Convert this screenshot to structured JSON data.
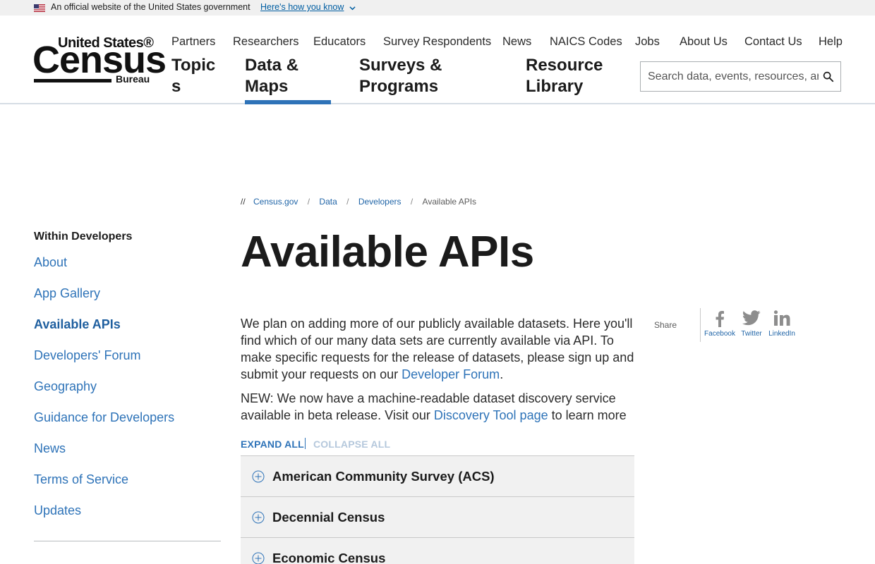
{
  "gov_banner": {
    "official_text": "An official website of the United States government",
    "how_link": "Here's how you know"
  },
  "logo": {
    "line1": "United States®",
    "line2": "Census",
    "line3": "Bureau"
  },
  "utility_nav": [
    "Partners",
    "Researchers",
    "Educators",
    "Survey Respondents",
    "News",
    "NAICS Codes",
    "Jobs",
    "About Us",
    "Contact Us",
    "Help"
  ],
  "main_nav": {
    "topics": "Topic s",
    "data_maps": "Data & Maps",
    "surveys": "Surveys & Programs",
    "resource": "Resource Library"
  },
  "search": {
    "placeholder": "Search data, events, resources, and more"
  },
  "breadcrumb": {
    "start": "//",
    "items": [
      "Census.gov",
      "Data",
      "Developers"
    ],
    "current": "Available APIs"
  },
  "sidebar": {
    "title": "Within Developers",
    "items": [
      "About",
      "App Gallery",
      "Available APIs",
      "Developers' Forum",
      "Geography",
      "Guidance for Developers",
      "News",
      "Terms of Service",
      "Updates"
    ]
  },
  "main": {
    "title": "Available APIs",
    "intro_text": "We plan on adding more of our publicly available datasets. Here you'll find which of our many data sets are currently available via API. To make specific requests for the release of datasets, please sign up and submit your requests on our ",
    "intro_link": "Developer Forum",
    "intro_end": ".",
    "new_text": "NEW: We now have a machine-readable dataset discovery service available in beta release. Visit our ",
    "new_link": "Discovery Tool page",
    "new_end": " to learn more",
    "expand_all": "EXPAND ALL",
    "collapse_all": "COLLAPSE ALL",
    "accordion": [
      "American Community Survey (ACS)",
      "Decennial Census",
      "Economic Census"
    ]
  },
  "share": {
    "label": "Share",
    "facebook": "Facebook",
    "twitter": "Twitter",
    "linkedin": "LinkedIn"
  },
  "colors": {
    "link": "#2e73b8",
    "active_underline": "#2e73b8",
    "accordion_bg": "#f1f1f1"
  }
}
